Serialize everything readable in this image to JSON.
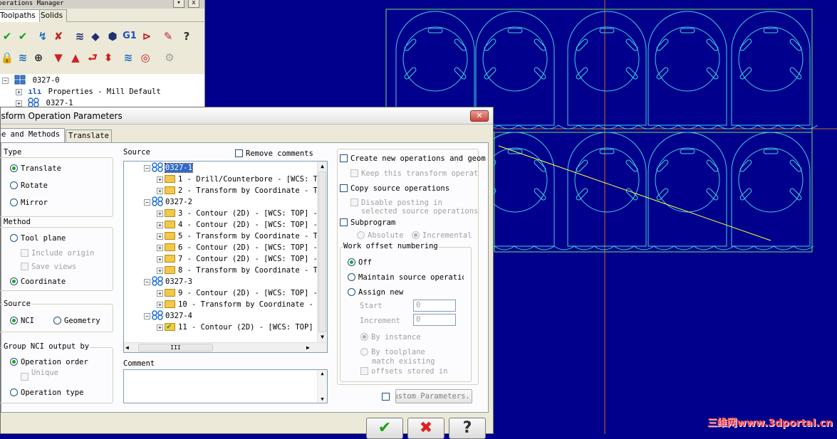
{
  "ops_manager": {
    "title": "Operations Manager",
    "tabs": [
      "Toolpaths",
      "Solids"
    ],
    "tree": [
      {
        "label": "0327-0"
      },
      {
        "label": "Properties - Mill Default"
      },
      {
        "label": "0327-1"
      }
    ]
  },
  "dialog": {
    "title": "Transform Operation Parameters",
    "tabs": [
      "Type and Methods",
      "Translate"
    ],
    "type": {
      "label": "Type",
      "options": [
        "Translate",
        "Rotate",
        "Mirror"
      ]
    },
    "method": {
      "label": "Method",
      "options": [
        "Tool plane",
        "Include origin",
        "Save views",
        "Coordinate"
      ]
    },
    "source_opt": {
      "label": "Source",
      "options": [
        "NCI",
        "Geometry"
      ]
    },
    "group_nci": {
      "label": "Group NCI output by",
      "options": [
        "Operation order",
        "Unique",
        "Operation type"
      ]
    },
    "source": {
      "label": "Source",
      "remove_comments": "Remove comments",
      "rows": [
        {
          "text": "0327-1",
          "kind": "group"
        },
        {
          "text": "1 - Drill/Counterbore - [WCS: T",
          "kind": "op"
        },
        {
          "text": "2 - Transform by Coordinate - T",
          "kind": "op"
        },
        {
          "text": "0327-2",
          "kind": "group"
        },
        {
          "text": "3 - Contour (2D) - [WCS: TOP] -",
          "kind": "op"
        },
        {
          "text": "4 - Contour (2D) - [WCS: TOP] -",
          "kind": "op"
        },
        {
          "text": "5 - Transform by Coordinate - T",
          "kind": "op"
        },
        {
          "text": "6 - Contour (2D) - [WCS: TOP] -",
          "kind": "op"
        },
        {
          "text": "7 - Contour (2D) - [WCS: TOP] -",
          "kind": "op"
        },
        {
          "text": "8 - Transform by Coordinate - T",
          "kind": "op"
        },
        {
          "text": "0327-3",
          "kind": "group"
        },
        {
          "text": "9 - Contour (2D) - [WCS: TOP] -",
          "kind": "op"
        },
        {
          "text": "10 - Transform by Coordinate -",
          "kind": "op"
        },
        {
          "text": "0327-4",
          "kind": "group"
        },
        {
          "text": "11 - Contour (2D) - [WCS: TOP]",
          "kind": "op"
        }
      ],
      "hscroll_thumb": "III"
    },
    "comment_label": "Comment",
    "right": {
      "create_new": "Create new operations and geom",
      "keep_transform": "Keep this transform operat",
      "copy_source": "Copy source operations",
      "disable_posting_1": "Disable posting in",
      "disable_posting_2": "selected source operations",
      "subprogram": "Subprogram",
      "absolute": "Absolute",
      "incremental": "Incremental",
      "work_offset": {
        "label": "Work offset numbering",
        "off": "Off",
        "maintain": "Maintain source operation",
        "assign_new": "Assign new",
        "start_label": "Start",
        "start_value": "0",
        "increment_label": "Increment",
        "increment_value": "0",
        "by_instance": "By instance",
        "by_toolplane": "By toolplane",
        "match_1": "match existing",
        "match_2": "offsets stored in"
      },
      "custom_params": "Custom Parameters."
    },
    "buttons": {
      "ok": "✔",
      "cancel": "✖",
      "help": "?"
    }
  },
  "watermark": "三维网www.3dportal.cn",
  "colors": {
    "background": "#00008c",
    "part": "#3fd0e0",
    "bounds": "#70e070",
    "axis": "#c87020",
    "chain": "#ffff40"
  }
}
